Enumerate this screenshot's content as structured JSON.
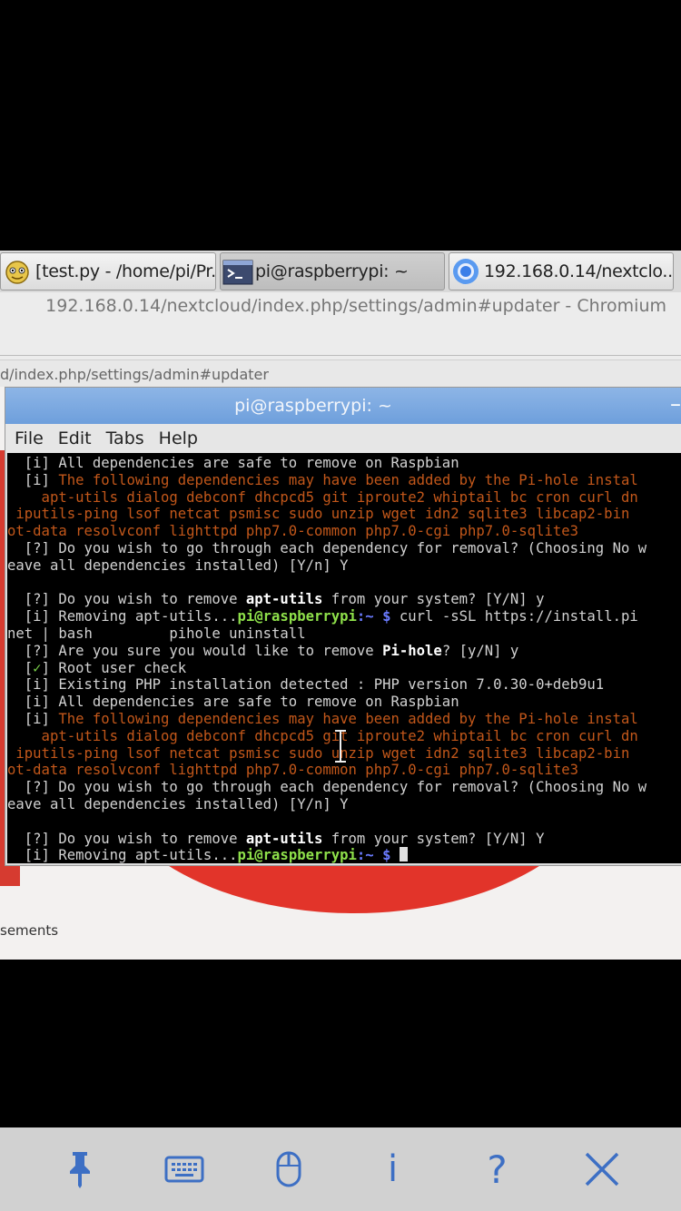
{
  "taskbar": {
    "tasks": [
      {
        "label": "[test.py - /home/pi/Pr...",
        "icon": "python-editor-icon"
      },
      {
        "label": "pi@raspberrypi: ~",
        "icon": "terminal-icon",
        "active": true
      },
      {
        "label": "192.168.0.14/nextclo...",
        "icon": "chromium-icon"
      }
    ]
  },
  "browser": {
    "window_title": "192.168.0.14/nextcloud/index.php/settings/admin#updater - Chromium",
    "url_fragment": "d/index.php/settings/admin#updater",
    "page_partial_text": "sements"
  },
  "terminal": {
    "title": "pi@raspberrypi: ~",
    "close_glyph": "–",
    "menu": [
      "File",
      "Edit",
      "Tabs",
      "Help"
    ],
    "lines": [
      [
        {
          "t": "  [i] All dependencies are safe to remove on Raspbian"
        }
      ],
      [
        {
          "t": "  [i] "
        },
        {
          "t": "The following dependencies may have been added by the Pi-hole instal",
          "c": "org"
        }
      ],
      [
        {
          "t": "    apt-utils dialog debconf dhcpcd5 git iproute2 whiptail bc cron curl dn",
          "c": "org"
        }
      ],
      [
        {
          "t": " iputils-ping lsof netcat psmisc sudo unzip wget idn2 sqlite3 libcap2-bin",
          "c": "org"
        }
      ],
      [
        {
          "t": "ot-data resolvconf lighttpd php7.0-common php7.0-cgi php7.0-sqlite3",
          "c": "org"
        }
      ],
      [
        {
          "t": "  [?] Do you wish to go through each dependency for removal? (Choosing No w"
        }
      ],
      [
        {
          "t": "eave all dependencies installed) [Y/n] Y"
        }
      ],
      [
        {
          "t": ""
        }
      ],
      [
        {
          "t": "  [?] Do you wish to remove "
        },
        {
          "t": "apt-utils",
          "c": "bold"
        },
        {
          "t": " from your system? [Y/N] y"
        }
      ],
      [
        {
          "t": "  [i] Removing apt-utils..."
        },
        {
          "t": "pi@raspberrypi",
          "c": "grn"
        },
        {
          "t": ":~ $",
          "c": "blu"
        },
        {
          "t": " curl -sSL https://install.pi"
        }
      ],
      [
        {
          "t": "net | bash         pihole uninstall"
        }
      ],
      [
        {
          "t": "  [?] Are you sure you would like to remove "
        },
        {
          "t": "Pi-hole",
          "c": "bold"
        },
        {
          "t": "? [y/N] y"
        }
      ],
      [
        {
          "t": "  ["
        },
        {
          "t": "✓",
          "c": "ok"
        },
        {
          "t": "] Root user check"
        }
      ],
      [
        {
          "t": "  [i] Existing PHP installation detected : PHP version 7.0.30-0+deb9u1"
        }
      ],
      [
        {
          "t": "  [i] All dependencies are safe to remove on Raspbian"
        }
      ],
      [
        {
          "t": "  [i] "
        },
        {
          "t": "The following dependencies may have been added by the Pi-hole instal",
          "c": "org"
        }
      ],
      [
        {
          "t": "    apt-utils dialog debconf dhcpcd5 git iproute2 whiptail bc cron curl dn",
          "c": "org"
        }
      ],
      [
        {
          "t": " iputils-ping lsof netcat psmisc sudo unzip wget idn2 sqlite3 libcap2-bin",
          "c": "org"
        }
      ],
      [
        {
          "t": "ot-data resolvconf lighttpd php7.0-common php7.0-cgi php7.0-sqlite3",
          "c": "org"
        }
      ],
      [
        {
          "t": "  [?] Do you wish to go through each dependency for removal? (Choosing No w"
        }
      ],
      [
        {
          "t": "eave all dependencies installed) [Y/n] Y"
        }
      ],
      [
        {
          "t": ""
        }
      ],
      [
        {
          "t": "  [?] Do you wish to remove "
        },
        {
          "t": "apt-utils",
          "c": "bold"
        },
        {
          "t": " from your system? [Y/N] Y"
        }
      ],
      [
        {
          "t": "  [i] Removing apt-utils..."
        },
        {
          "t": "pi@raspberrypi",
          "c": "grn"
        },
        {
          "t": ":~ $ ",
          "c": "blu"
        }
      ]
    ]
  },
  "toolbar": {
    "buttons": [
      {
        "name": "pin-icon"
      },
      {
        "name": "keyboard-icon"
      },
      {
        "name": "mouse-icon"
      },
      {
        "name": "info-icon",
        "glyph": "i"
      },
      {
        "name": "help-icon",
        "glyph": "?"
      },
      {
        "name": "close-icon"
      }
    ]
  },
  "colors": {
    "terminal_orange": "#c2571a",
    "prompt_green": "#8ee04a",
    "prompt_blue": "#6a7bff",
    "toolbar_icon": "#3d6fc4",
    "title_bar": "#7aa7e0"
  }
}
